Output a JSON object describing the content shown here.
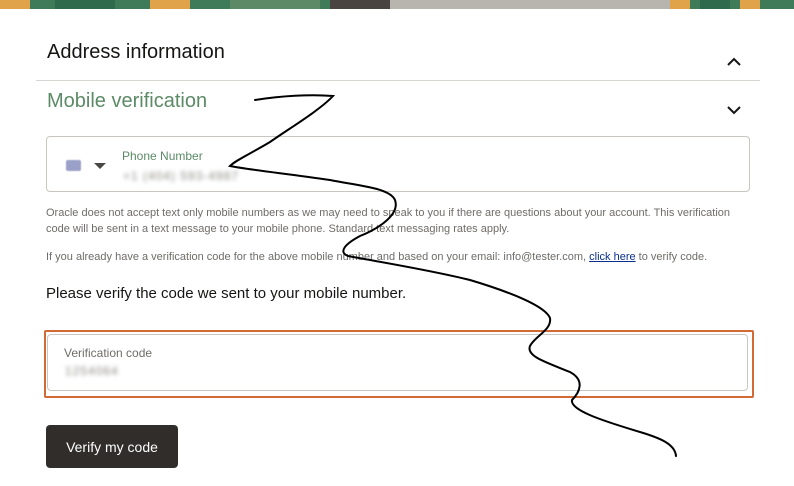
{
  "address_section": {
    "title": "Address information",
    "expanded": true
  },
  "mobile_section": {
    "title": "Mobile verification",
    "expanded": false
  },
  "phone": {
    "label": "Phone Number",
    "value": "+1 (404) 593-4987",
    "country_flag": "us-flag-icon"
  },
  "info_text_1": "Oracle does not accept text only mobile numbers as we may need to speak to you if there are questions about your account. This verification code will be sent in a text message to your mobile phone. Standard text messaging rates apply.",
  "info_text_2_before": "If you already have a verification code for the above mobile number and based on your email: info@tester.com, ",
  "info_text_2_link": "click here",
  "info_text_2_after": " to verify code.",
  "prompt": "Please verify the code we sent to your mobile number.",
  "verification": {
    "label": "Verification code",
    "value": "1254064"
  },
  "verify_button": "Verify my code",
  "colors": {
    "accent_green": "#5c8a66",
    "focus_orange": "#d36a35",
    "button_dark": "#312d2a",
    "link_blue": "#0a2e8f"
  }
}
